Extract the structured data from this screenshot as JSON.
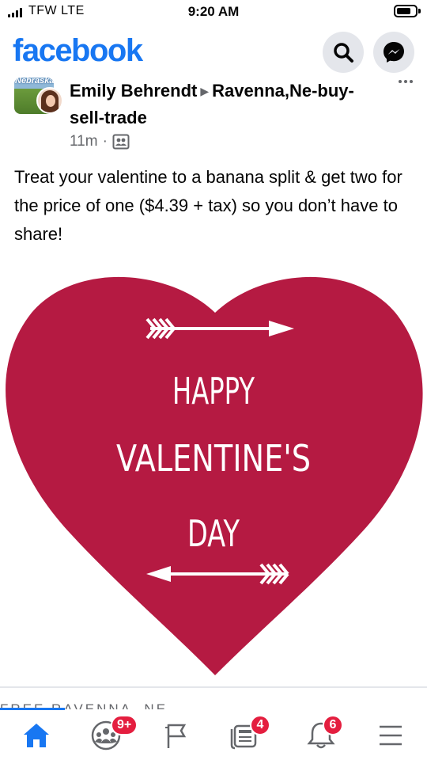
{
  "status_bar": {
    "carrier": "TFW  LTE",
    "time": "9:20 AM"
  },
  "header": {
    "logo": "facebook",
    "search_icon": "search-icon",
    "messenger_icon": "messenger-icon",
    "brand_color": "#1877f2"
  },
  "post": {
    "group_thumb_label": "Nebraska",
    "author": "Emily Behrendt",
    "group": "Ravenna,Ne-buy-sell-trade",
    "time": "11m",
    "privacy_icon": "group-privacy-icon",
    "text": "Treat your valentine to a banana split & get two for the price of one ($4.39 + tax) so you don’t have to share!",
    "image": {
      "line1": "Happy",
      "line2": "Valentine's",
      "line3": "Day",
      "heart_color": "#b51a42"
    }
  },
  "next_post": {
    "partial_text": "FREE    RAVENNA, NE"
  },
  "tab_bar": {
    "tabs": [
      {
        "name": "home",
        "icon": "home-icon",
        "badge": ""
      },
      {
        "name": "groups",
        "icon": "groups-icon",
        "badge": "9+"
      },
      {
        "name": "pages",
        "icon": "flag-icon",
        "badge": ""
      },
      {
        "name": "news",
        "icon": "news-icon",
        "badge": "4"
      },
      {
        "name": "notifications",
        "icon": "bell-icon",
        "badge": "6"
      },
      {
        "name": "menu",
        "icon": "menu-icon",
        "badge": ""
      }
    ]
  }
}
